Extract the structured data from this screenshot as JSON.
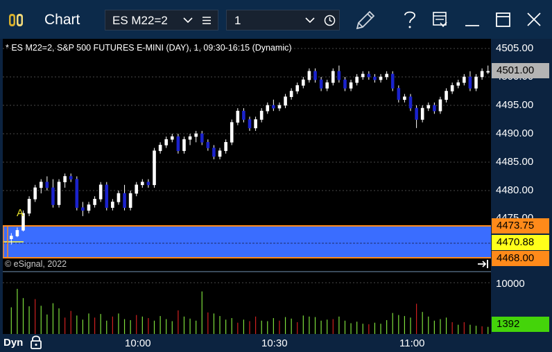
{
  "window": {
    "title": "Chart",
    "symbol": "ES M22=2",
    "interval": "1"
  },
  "pane": {
    "title": "* ES M22=2, S&P 500 FUTURES E-MINI (DAY), 1, 09:30-16:15 (Dynamic)",
    "copyright": "© eSignal, 2022",
    "marker_label": "A"
  },
  "price_axis": {
    "labels": [
      "4505.00",
      "4500.00",
      "4495.00",
      "4490.00",
      "4485.00",
      "4480.00",
      "4475.00"
    ],
    "last_price": "4501.00",
    "band_high": "4473.75",
    "band_mid": "4470.88",
    "band_low": "4468.00"
  },
  "volume_axis": {
    "label": "10000",
    "last_volume": "1392"
  },
  "time_axis": {
    "labels": [
      "10:00",
      "10:30",
      "11:00"
    ]
  },
  "bottom": {
    "mode": "Dyn"
  },
  "colors": {
    "up_candle": "#ffffff",
    "down_candle": "#1a22cc",
    "band_fill": "#3a6dff",
    "band_border": "#ff8a1a",
    "last_price_bg": "#b4b4b4",
    "band_mid_bg": "#ffff1a",
    "volume_up": "#7ee03c",
    "volume_down": "#d02020",
    "last_volume_bg": "#44d40a"
  },
  "chart_data": {
    "type": "candlestick",
    "x_time_labels": [
      "10:00",
      "10:30",
      "11:00"
    ],
    "y_range": [
      4474,
      4506
    ],
    "series": [
      {
        "values": [
          [
            4471.5,
            4472.5,
            4470.5,
            4472.0
          ],
          [
            4472.0,
            4473.5,
            4471.8,
            4473.0
          ],
          [
            4473.0,
            4476.5,
            4472.8,
            4476.0
          ],
          [
            4476.0,
            4479.0,
            4475.5,
            4478.5
          ],
          [
            4478.5,
            4481.0,
            4478.0,
            4480.5
          ],
          [
            4480.5,
            4482.0,
            4479.5,
            4481.5
          ],
          [
            4481.5,
            4482.5,
            4480.0,
            4480.5
          ],
          [
            4480.5,
            4482.0,
            4477.0,
            4477.5
          ],
          [
            4477.5,
            4482.0,
            4477.0,
            4481.5
          ],
          [
            4481.5,
            4483.0,
            4480.5,
            4482.5
          ],
          [
            4482.5,
            4483.0,
            4481.5,
            4482.0
          ],
          [
            4482.0,
            4482.5,
            4476.5,
            4477.0
          ],
          [
            4477.0,
            4478.0,
            4475.5,
            4476.5
          ],
          [
            4476.5,
            4478.0,
            4476.0,
            4477.5
          ],
          [
            4477.5,
            4479.0,
            4477.0,
            4478.5
          ],
          [
            4478.5,
            4481.5,
            4478.0,
            4481.0
          ],
          [
            4481.0,
            4481.5,
            4476.5,
            4477.0
          ],
          [
            4477.0,
            4478.5,
            4476.5,
            4478.0
          ],
          [
            4478.0,
            4480.0,
            4477.5,
            4479.5
          ],
          [
            4479.5,
            4481.0,
            4476.5,
            4477.0
          ],
          [
            4477.0,
            4480.0,
            4476.5,
            4479.5
          ],
          [
            4479.5,
            4481.5,
            4479.0,
            4481.0
          ],
          [
            4481.0,
            4482.0,
            4480.5,
            4481.5
          ],
          [
            4481.5,
            4482.0,
            4480.5,
            4481.0
          ],
          [
            4481.0,
            4487.5,
            4480.5,
            4487.0
          ],
          [
            4487.0,
            4488.5,
            4486.5,
            4488.0
          ],
          [
            4488.0,
            4489.5,
            4487.5,
            4489.0
          ],
          [
            4489.0,
            4490.0,
            4488.5,
            4489.5
          ],
          [
            4489.5,
            4490.0,
            4486.5,
            4487.0
          ],
          [
            4487.0,
            4489.5,
            4486.5,
            4489.0
          ],
          [
            4489.0,
            4490.0,
            4488.0,
            4489.5
          ],
          [
            4489.5,
            4490.5,
            4488.5,
            4490.0
          ],
          [
            4490.0,
            4490.5,
            4488.0,
            4488.5
          ],
          [
            4488.5,
            4489.0,
            4487.0,
            4487.5
          ],
          [
            4487.5,
            4488.0,
            4485.5,
            4486.0
          ],
          [
            4486.0,
            4487.5,
            4485.5,
            4487.0
          ],
          [
            4487.0,
            4489.0,
            4486.5,
            4488.5
          ],
          [
            4488.5,
            4492.5,
            4488.0,
            4492.0
          ],
          [
            4492.0,
            4494.5,
            4491.5,
            4494.0
          ],
          [
            4494.0,
            4494.5,
            4492.0,
            4492.5
          ],
          [
            4492.5,
            4493.0,
            4490.5,
            4491.0
          ],
          [
            4491.0,
            4493.0,
            4490.5,
            4492.5
          ],
          [
            4492.5,
            4494.5,
            4492.0,
            4494.0
          ],
          [
            4494.0,
            4495.5,
            4493.5,
            4495.0
          ],
          [
            4495.0,
            4496.0,
            4494.0,
            4494.5
          ],
          [
            4494.5,
            4495.5,
            4494.0,
            4495.0
          ],
          [
            4495.0,
            4497.0,
            4494.5,
            4496.5
          ],
          [
            4496.5,
            4498.0,
            4496.0,
            4497.5
          ],
          [
            4497.5,
            4499.0,
            4497.0,
            4498.5
          ],
          [
            4498.5,
            4500.0,
            4498.0,
            4499.5
          ],
          [
            4499.5,
            4501.5,
            4499.0,
            4501.0
          ],
          [
            4501.0,
            4501.5,
            4499.0,
            4499.5
          ],
          [
            4499.5,
            4500.0,
            4497.5,
            4498.0
          ],
          [
            4498.0,
            4499.5,
            4497.5,
            4499.0
          ],
          [
            4499.0,
            4501.5,
            4498.5,
            4501.0
          ],
          [
            4501.0,
            4502.0,
            4499.0,
            4499.5
          ],
          [
            4499.5,
            4500.0,
            4497.5,
            4498.0
          ],
          [
            4498.0,
            4499.5,
            4497.5,
            4499.0
          ],
          [
            4499.0,
            4500.5,
            4498.5,
            4500.0
          ],
          [
            4500.0,
            4501.0,
            4499.5,
            4500.5
          ],
          [
            4500.5,
            4501.0,
            4499.5,
            4500.0
          ],
          [
            4500.0,
            4500.5,
            4499.0,
            4499.5
          ],
          [
            4499.5,
            4500.5,
            4499.0,
            4500.0
          ],
          [
            4500.0,
            4501.0,
            4499.5,
            4500.5
          ],
          [
            4500.5,
            4501.0,
            4497.5,
            4498.0
          ],
          [
            4498.0,
            4498.5,
            4495.5,
            4496.0
          ],
          [
            4496.0,
            4497.0,
            4495.5,
            4496.5
          ],
          [
            4496.5,
            4497.0,
            4494.0,
            4494.5
          ],
          [
            4494.5,
            4495.0,
            4491.0,
            4492.5
          ],
          [
            4492.5,
            4495.0,
            4492.0,
            4494.5
          ],
          [
            4494.5,
            4495.5,
            4494.0,
            4495.0
          ],
          [
            4495.0,
            4495.5,
            4493.5,
            4494.0
          ],
          [
            4494.0,
            4496.5,
            4493.5,
            4496.0
          ],
          [
            4496.0,
            4498.0,
            4495.5,
            4497.5
          ],
          [
            4497.5,
            4499.0,
            4497.0,
            4498.5
          ],
          [
            4498.5,
            4499.5,
            4498.0,
            4499.0
          ],
          [
            4499.0,
            4500.5,
            4498.5,
            4500.0
          ],
          [
            4500.0,
            4501.0,
            4497.5,
            4498.0
          ],
          [
            4498.0,
            4500.5,
            4497.5,
            4500.0
          ],
          [
            4500.0,
            4501.5,
            4499.5,
            4501.0
          ],
          [
            4501.0,
            4502.0,
            4500.5,
            4501.0
          ]
        ]
      }
    ],
    "volume": [
      [
        5200,
        1
      ],
      [
        8800,
        1
      ],
      [
        7000,
        1
      ],
      [
        5400,
        1
      ],
      [
        6800,
        0
      ],
      [
        5500,
        1
      ],
      [
        3800,
        1
      ],
      [
        6000,
        1
      ],
      [
        5000,
        1
      ],
      [
        3200,
        0
      ],
      [
        4500,
        0
      ],
      [
        3600,
        1
      ],
      [
        2800,
        1
      ],
      [
        4000,
        1
      ],
      [
        3200,
        0
      ],
      [
        3900,
        1
      ],
      [
        2600,
        1
      ],
      [
        3400,
        0
      ],
      [
        4000,
        1
      ],
      [
        2900,
        1
      ],
      [
        2700,
        1
      ],
      [
        3700,
        0
      ],
      [
        3400,
        1
      ],
      [
        3100,
        0
      ],
      [
        2600,
        1
      ],
      [
        3500,
        1
      ],
      [
        2900,
        1
      ],
      [
        2500,
        1
      ],
      [
        4600,
        0
      ],
      [
        3400,
        1
      ],
      [
        3000,
        1
      ],
      [
        2600,
        1
      ],
      [
        8300,
        1
      ],
      [
        4200,
        0
      ],
      [
        4000,
        1
      ],
      [
        3500,
        1
      ],
      [
        2800,
        1
      ],
      [
        3100,
        1
      ],
      [
        2200,
        0
      ],
      [
        2800,
        1
      ],
      [
        2500,
        0
      ],
      [
        3400,
        0
      ],
      [
        2600,
        1
      ],
      [
        2500,
        1
      ],
      [
        3100,
        1
      ],
      [
        2600,
        0
      ],
      [
        3300,
        1
      ],
      [
        3000,
        1
      ],
      [
        2300,
        0
      ],
      [
        3600,
        1
      ],
      [
        3400,
        1
      ],
      [
        3300,
        1
      ],
      [
        2600,
        1
      ],
      [
        2800,
        1
      ],
      [
        2900,
        0
      ],
      [
        3400,
        1
      ],
      [
        2600,
        1
      ],
      [
        2100,
        1
      ],
      [
        2400,
        1
      ],
      [
        2000,
        1
      ],
      [
        1900,
        0
      ],
      [
        2200,
        1
      ],
      [
        2000,
        1
      ],
      [
        2700,
        1
      ],
      [
        4100,
        1
      ],
      [
        3700,
        1
      ],
      [
        3500,
        1
      ],
      [
        3200,
        1
      ],
      [
        5900,
        0
      ],
      [
        4300,
        1
      ],
      [
        3400,
        1
      ],
      [
        2600,
        1
      ],
      [
        2900,
        1
      ],
      [
        3200,
        1
      ],
      [
        2300,
        0
      ],
      [
        1800,
        1
      ],
      [
        2300,
        0
      ],
      [
        1800,
        1
      ],
      [
        1600,
        1
      ],
      [
        1500,
        0
      ],
      [
        1392,
        1
      ]
    ],
    "volume_axis_label": "10000"
  }
}
